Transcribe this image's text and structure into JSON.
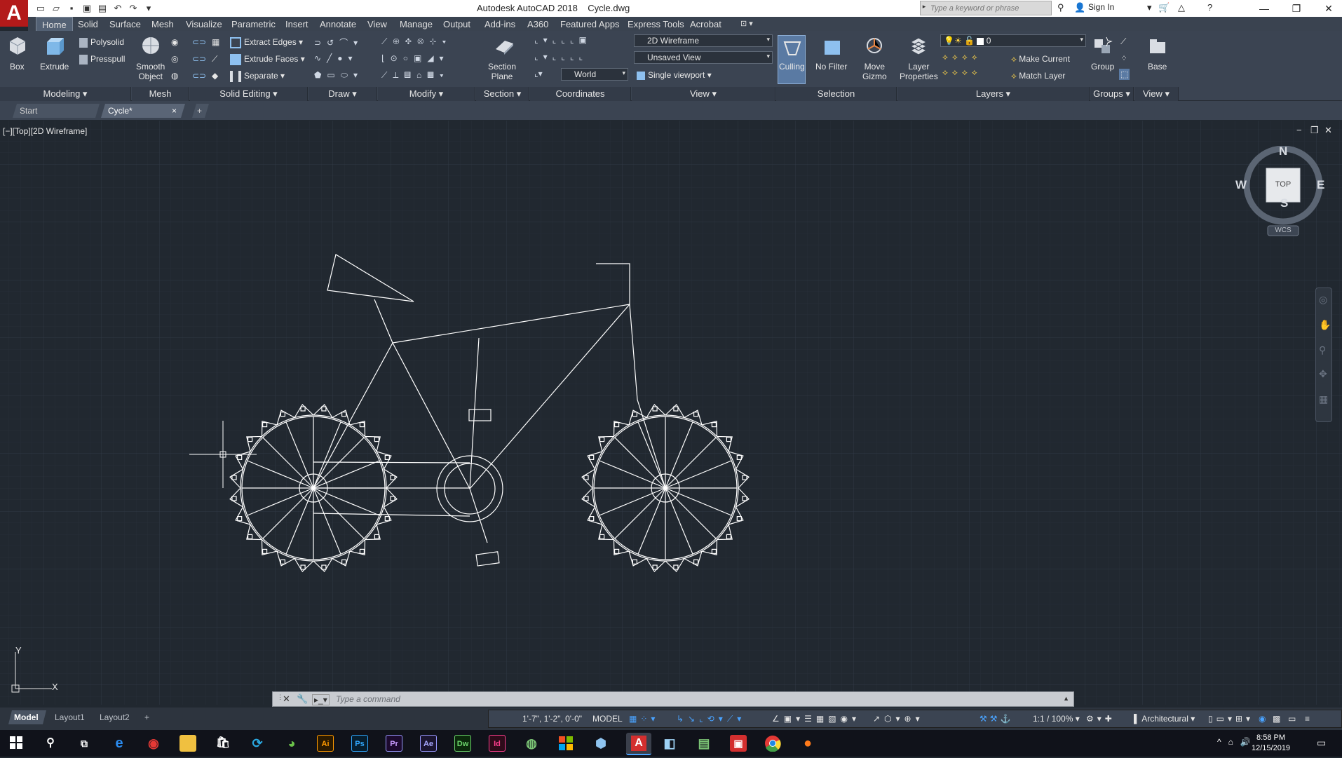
{
  "app": {
    "logo": "A",
    "title": "Autodesk AutoCAD 2018    Cycle.dwg",
    "search_placeholder": "Type a keyword or phrase",
    "sign_in": "Sign In"
  },
  "menu_tabs": [
    "Home",
    "Solid",
    "Surface",
    "Mesh",
    "Visualize",
    "Parametric",
    "Insert",
    "Annotate",
    "View",
    "Manage",
    "Output",
    "Add-ins",
    "A360",
    "Featured Apps",
    "Express Tools",
    "Acrobat"
  ],
  "ribbon": {
    "modeling": {
      "box": "Box",
      "extrude": "Extrude",
      "polysolid": "Polysolid",
      "presspull": "Presspull",
      "label": "Modeling ▾"
    },
    "mesh": {
      "smooth_object": "Smooth\nObject",
      "label": "Mesh"
    },
    "solid_editing": {
      "extract_edges": "Extract Edges",
      "extrude_faces": "Extrude Faces",
      "separate": "Separate",
      "label": "Solid Editing ▾"
    },
    "draw": {
      "label": "Draw ▾"
    },
    "modify": {
      "label": "Modify ▾"
    },
    "section": {
      "section_plane": "Section\nPlane",
      "label": "Section ▾"
    },
    "coordinates": {
      "world": "World",
      "label": "Coordinates"
    },
    "view": {
      "visual_style": "2D Wireframe",
      "named_view": "Unsaved View",
      "viewport": "Single viewport",
      "label": "View ▾"
    },
    "selection": {
      "culling": "Culling",
      "no_filter": "No Filter",
      "move_gizmo": "Move\nGizmo",
      "label": "Selection"
    },
    "layers": {
      "layer_properties": "Layer\nProperties",
      "current_layer": "0",
      "make_current": "Make Current",
      "match_layer": "Match Layer",
      "label": "Layers ▾"
    },
    "groups": {
      "group": "Group",
      "label": "Groups ▾"
    },
    "view2": {
      "base": "Base",
      "label": "View ▾"
    }
  },
  "doc_tabs": {
    "start": "Start",
    "active": "Cycle*",
    "close": "×",
    "add": "+"
  },
  "viewport": {
    "label": "[−][Top][2D Wireframe]",
    "controls": [
      "−",
      "❐",
      "✕"
    ],
    "viewcube": {
      "n": "N",
      "s": "S",
      "e": "E",
      "w": "W",
      "face": "TOP",
      "wcs": "WCS"
    },
    "ucs": {
      "x": "X",
      "y": "Y"
    }
  },
  "command": {
    "placeholder": "Type a command"
  },
  "layout_tabs": [
    "Model",
    "Layout1",
    "Layout2"
  ],
  "status": {
    "coords": "1'-7\", 1'-2\", 0'-0\"",
    "model": "MODEL",
    "scale": "1:1 / 100%",
    "units": "Architectural"
  },
  "taskbar": {
    "apps": [
      "Ai",
      "Ps",
      "Pr",
      "Ae",
      "Dw",
      "Id"
    ],
    "time": "8:58 PM",
    "date": "12/15/2019"
  },
  "colors": {
    "canvas": "#212830",
    "ribbon": "#3b4452",
    "accent": "#b31a1a",
    "drawing": "#ffffff"
  }
}
